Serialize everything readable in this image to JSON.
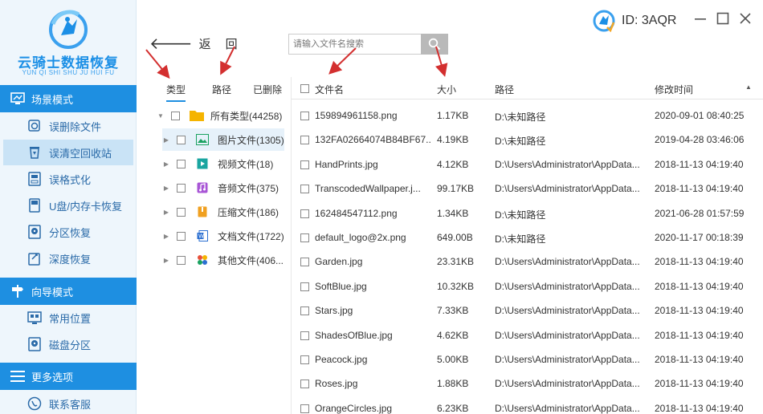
{
  "app": {
    "logo_title": "云骑士数据恢复",
    "logo_sub": "YUN QI SHI SHU JU HUI FU",
    "user_id": "ID: 3AQR"
  },
  "sidebar": {
    "sections": [
      {
        "label": "场景模式",
        "items": [
          {
            "label": "误删除文件",
            "icon": "deleted-file-icon",
            "active": false
          },
          {
            "label": "误清空回收站",
            "icon": "recycle-bin-icon",
            "active": true
          },
          {
            "label": "误格式化",
            "icon": "format-disk-icon",
            "active": false
          },
          {
            "label": "U盘/内存卡恢复",
            "icon": "usb-card-icon",
            "active": false
          },
          {
            "label": "分区恢复",
            "icon": "partition-icon",
            "active": false
          },
          {
            "label": "深度恢复",
            "icon": "deep-recovery-icon",
            "active": false
          }
        ]
      },
      {
        "label": "向导模式",
        "items": [
          {
            "label": "常用位置",
            "icon": "common-location-icon",
            "active": false
          },
          {
            "label": "磁盘分区",
            "icon": "disk-partition-icon",
            "active": false
          }
        ]
      },
      {
        "label": "更多选项",
        "items": [
          {
            "label": "联系客服",
            "icon": "customer-service-icon",
            "active": false
          }
        ]
      }
    ]
  },
  "toolbar": {
    "back_arrow": "🡐",
    "back_label": "返回",
    "search_placeholder": "请输入文件名搜索"
  },
  "category_tabs": [
    "类型",
    "路径",
    "已删除"
  ],
  "categories": [
    {
      "label": "所有类型(44258)",
      "icon": "folder-icon",
      "color": "#f5b400",
      "selected": false,
      "root": true
    },
    {
      "label": "图片文件(1305)",
      "icon": "image-file-icon",
      "color": "#1aa260",
      "selected": true,
      "root": false
    },
    {
      "label": "视频文件(18)",
      "icon": "video-file-icon",
      "color": "#19a5a0",
      "selected": false,
      "root": false
    },
    {
      "label": "音频文件(375)",
      "icon": "audio-file-icon",
      "color": "#a855d6",
      "selected": false,
      "root": false
    },
    {
      "label": "压缩文件(186)",
      "icon": "archive-file-icon",
      "color": "#f0a020",
      "selected": false,
      "root": false
    },
    {
      "label": "文档文件(1722)",
      "icon": "document-file-icon",
      "color": "#2b6fd1",
      "selected": false,
      "root": false
    },
    {
      "label": "其他文件(406...",
      "icon": "other-file-icon",
      "color": "#e8503a",
      "selected": false,
      "root": false
    }
  ],
  "table": {
    "headers": {
      "name": "文件名",
      "size": "大小",
      "path": "路径",
      "mtime": "修改时间"
    },
    "rows": [
      {
        "name": "159894961158.png",
        "size": "1.17KB",
        "path": "D:\\未知路径",
        "mtime": "2020-09-01 08:40:25"
      },
      {
        "name": "132FA02664074B84BF67...",
        "size": "4.19KB",
        "path": "D:\\未知路径",
        "mtime": "2019-04-28 03:46:06"
      },
      {
        "name": "HandPrints.jpg",
        "size": "4.12KB",
        "path": "D:\\Users\\Administrator\\AppData...",
        "mtime": "2018-11-13 04:19:40"
      },
      {
        "name": "TranscodedWallpaper.j...",
        "size": "99.17KB",
        "path": "D:\\Users\\Administrator\\AppData...",
        "mtime": "2018-11-13 04:19:40"
      },
      {
        "name": "162484547112.png",
        "size": "1.34KB",
        "path": "D:\\未知路径",
        "mtime": "2021-06-28 01:57:59"
      },
      {
        "name": "default_logo@2x.png",
        "size": "649.00B",
        "path": "D:\\未知路径",
        "mtime": "2020-11-17 00:18:39"
      },
      {
        "name": "Garden.jpg",
        "size": "23.31KB",
        "path": "D:\\Users\\Administrator\\AppData...",
        "mtime": "2018-11-13 04:19:40"
      },
      {
        "name": "SoftBlue.jpg",
        "size": "10.32KB",
        "path": "D:\\Users\\Administrator\\AppData...",
        "mtime": "2018-11-13 04:19:40"
      },
      {
        "name": "Stars.jpg",
        "size": "7.33KB",
        "path": "D:\\Users\\Administrator\\AppData...",
        "mtime": "2018-11-13 04:19:40"
      },
      {
        "name": "ShadesOfBlue.jpg",
        "size": "4.62KB",
        "path": "D:\\Users\\Administrator\\AppData...",
        "mtime": "2018-11-13 04:19:40"
      },
      {
        "name": "Peacock.jpg",
        "size": "5.00KB",
        "path": "D:\\Users\\Administrator\\AppData...",
        "mtime": "2018-11-13 04:19:40"
      },
      {
        "name": "Roses.jpg",
        "size": "1.88KB",
        "path": "D:\\Users\\Administrator\\AppData...",
        "mtime": "2018-11-13 04:19:40"
      },
      {
        "name": "OrangeCircles.jpg",
        "size": "6.23KB",
        "path": "D:\\Users\\Administrator\\AppData...",
        "mtime": "2018-11-13 04:19:40"
      }
    ]
  },
  "colors": {
    "accent": "#1e8fe1",
    "annotation_arrow": "#d32f2f"
  }
}
